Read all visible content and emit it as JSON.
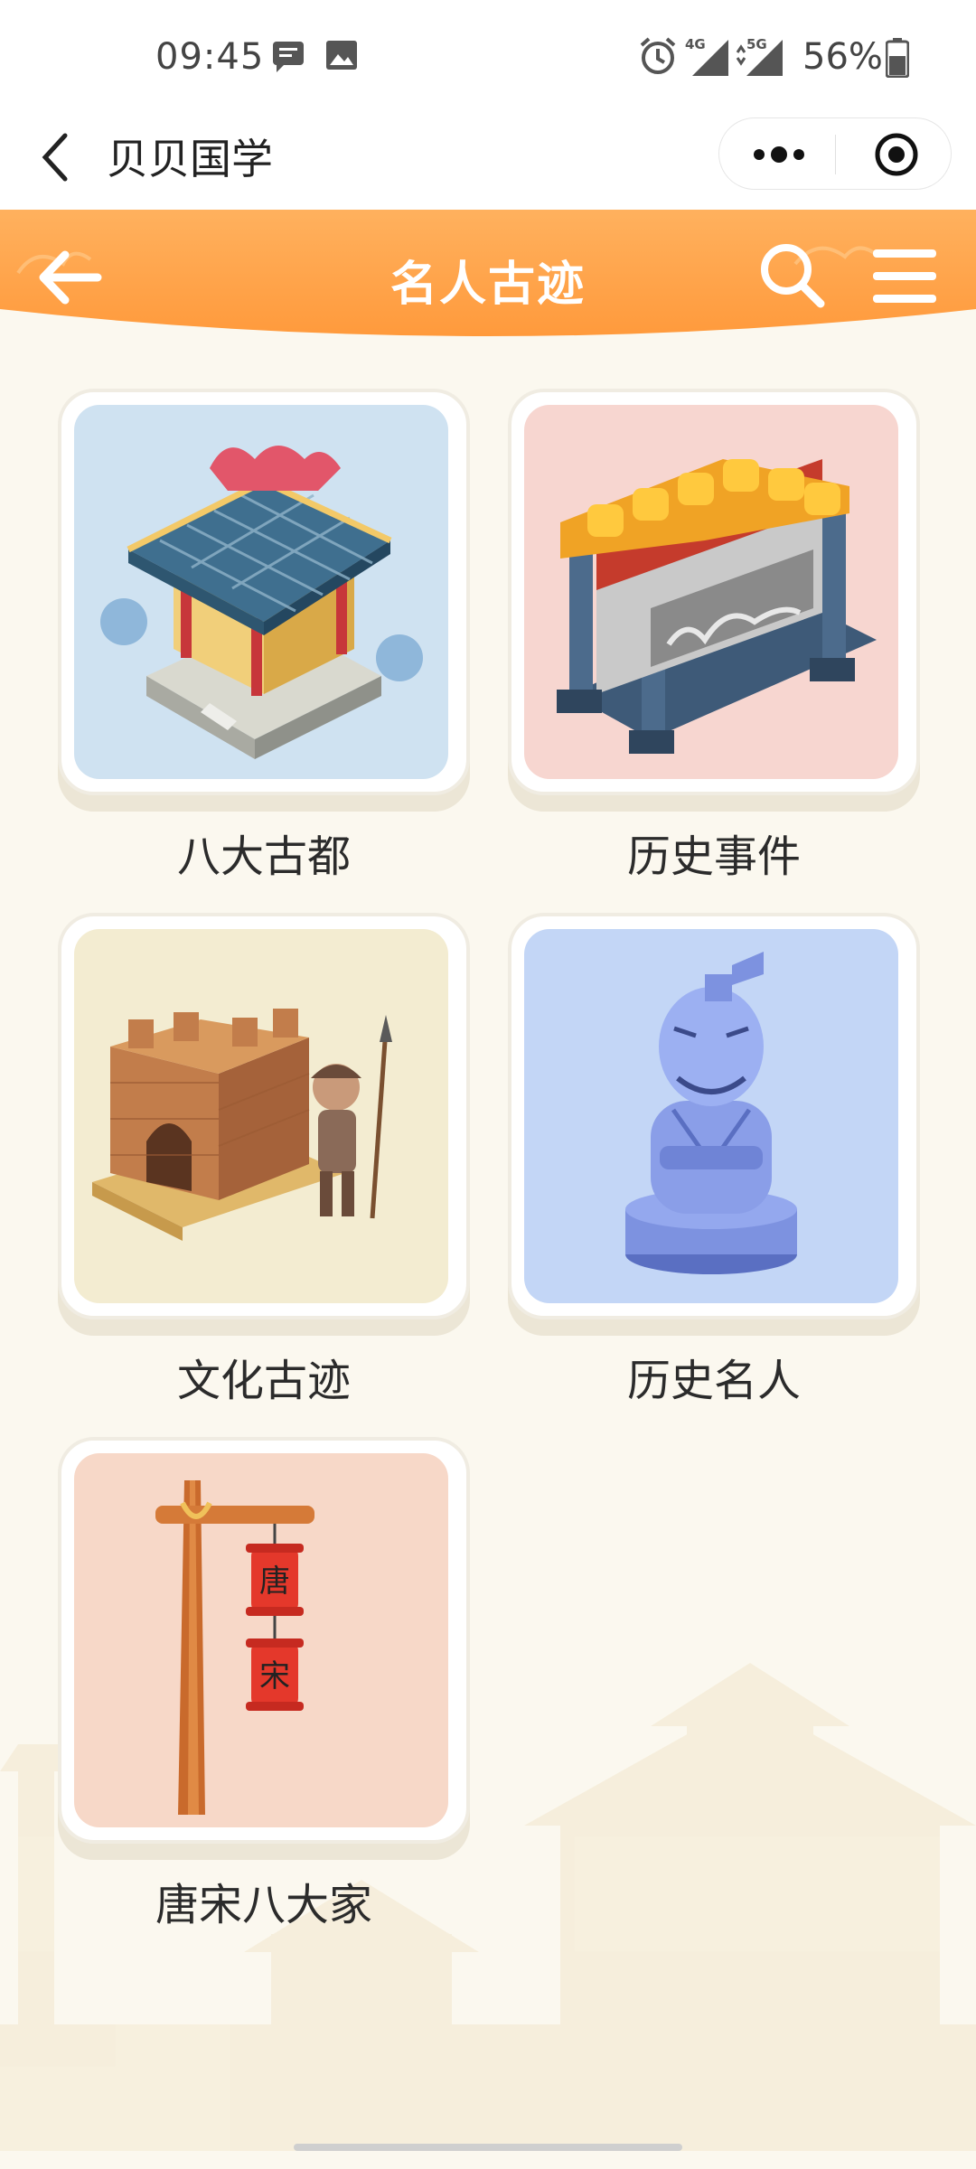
{
  "status_bar": {
    "time": "09:45",
    "signal_4g": "4G",
    "signal_5g": "5G",
    "battery": "56%"
  },
  "titlebar": {
    "app_name": "贝贝国学"
  },
  "header": {
    "title": "名人古迹"
  },
  "colors": {
    "orange": "#ff9a3c",
    "orange_light": "#ffc07a",
    "background": "#fbf8ef"
  },
  "categories": [
    {
      "label": "八大古都",
      "icon": "palace-illustration",
      "bg": "#cfe2f1"
    },
    {
      "label": "历史事件",
      "icon": "gate-illustration",
      "bg": "#f7d6d0"
    },
    {
      "label": "文化古迹",
      "icon": "great-wall-warrior-illustration",
      "bg": "#f3ecd1"
    },
    {
      "label": "历史名人",
      "icon": "terracotta-statue-illustration",
      "bg": "#c3d6f6"
    },
    {
      "label": "唐宋八大家",
      "icon": "lantern-pole-illustration",
      "bg": "#f7d8c8"
    }
  ],
  "lantern_text": [
    "唐",
    "宋"
  ]
}
